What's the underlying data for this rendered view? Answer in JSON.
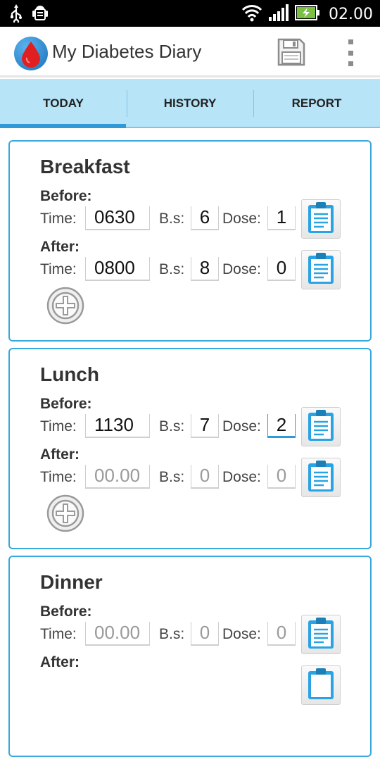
{
  "status_bar": {
    "time": "02.00",
    "icons": [
      "usb-icon",
      "android-debug-icon",
      "wifi-icon",
      "signal-icon",
      "battery-icon"
    ]
  },
  "action_bar": {
    "title": "My Diabetes Diary",
    "icons": [
      "blood-drop-logo-icon",
      "save-icon",
      "overflow-menu-icon"
    ]
  },
  "tabs": [
    {
      "label": "TODAY",
      "selected": true
    },
    {
      "label": "HISTORY",
      "selected": false
    },
    {
      "label": "REPORT",
      "selected": false
    }
  ],
  "labels": {
    "before": "Before:",
    "after": "After:",
    "time": "Time:",
    "bs": "B.s:",
    "dose": "Dose:"
  },
  "colors": {
    "accent": "#2f9ad6",
    "tab_background": "#b7e4f7",
    "card_border": "#39a8df",
    "logo_drop": "#e02020"
  },
  "meals": [
    {
      "name": "Breakfast",
      "before": {
        "time": "0630",
        "bs": "6",
        "dose": "1",
        "placeholder": false
      },
      "after": {
        "time": "0800",
        "bs": "8",
        "dose": "0",
        "placeholder": false
      }
    },
    {
      "name": "Lunch",
      "before": {
        "time": "1130",
        "bs": "7",
        "dose": "2",
        "placeholder": false
      },
      "after": {
        "time": "00.00",
        "bs": "0",
        "dose": "0",
        "placeholder": true
      }
    },
    {
      "name": "Dinner",
      "before": {
        "time": "00.00",
        "bs": "0",
        "dose": "0",
        "placeholder": true
      },
      "after": {
        "time": "",
        "bs": "",
        "dose": "",
        "placeholder": true
      }
    }
  ]
}
